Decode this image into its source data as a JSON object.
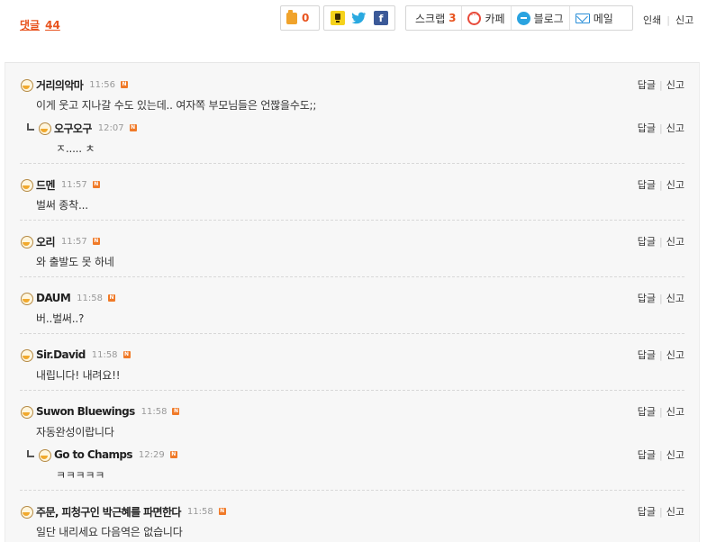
{
  "header": {
    "comment_label": "댓글",
    "comment_count": "44",
    "like_count": "0",
    "share": {
      "scrap_label": "스크랩",
      "scrap_count": "3",
      "cafe_label": "카페",
      "blog_label": "블로그",
      "mail_label": "메일"
    },
    "print_label": "인쇄",
    "report_label": "신고"
  },
  "actions": {
    "reply_label": "답글",
    "report_label": "신고"
  },
  "comments": [
    {
      "author": "거리의악마",
      "time": "11:56",
      "body": "이게 웃고 지나갈 수도 있는데.. 여자쪽 부모님들은 언짢을수도;;"
    },
    {
      "author": "오구오구",
      "time": "12:07",
      "body": "ㅈ..... ㅊ",
      "is_reply": true
    },
    {
      "author": "드멘",
      "time": "11:57",
      "body": "벌써 종착..."
    },
    {
      "author": "오리",
      "time": "11:57",
      "body": "와 출발도 못 하네"
    },
    {
      "author": "DAUM",
      "time": "11:58",
      "body": "버..벌써..?"
    },
    {
      "author": "Sir.David",
      "time": "11:58",
      "body": "내립니다! 내려요!!"
    },
    {
      "author": "Suwon Bluewings",
      "time": "11:58",
      "body": "자동완성이랍니다"
    },
    {
      "author": "Go to Champs",
      "time": "12:29",
      "body": "ㅋㅋㅋㅋㅋ",
      "is_reply": true
    },
    {
      "author": "주문, 피청구인 박근혜를 파면한다",
      "time": "11:58",
      "body": "일단 내리세요 다음역은 없습니다"
    }
  ],
  "colors": {
    "accent": "#e8531e",
    "badge": "#f07a28",
    "background": "#f7f7f7"
  }
}
